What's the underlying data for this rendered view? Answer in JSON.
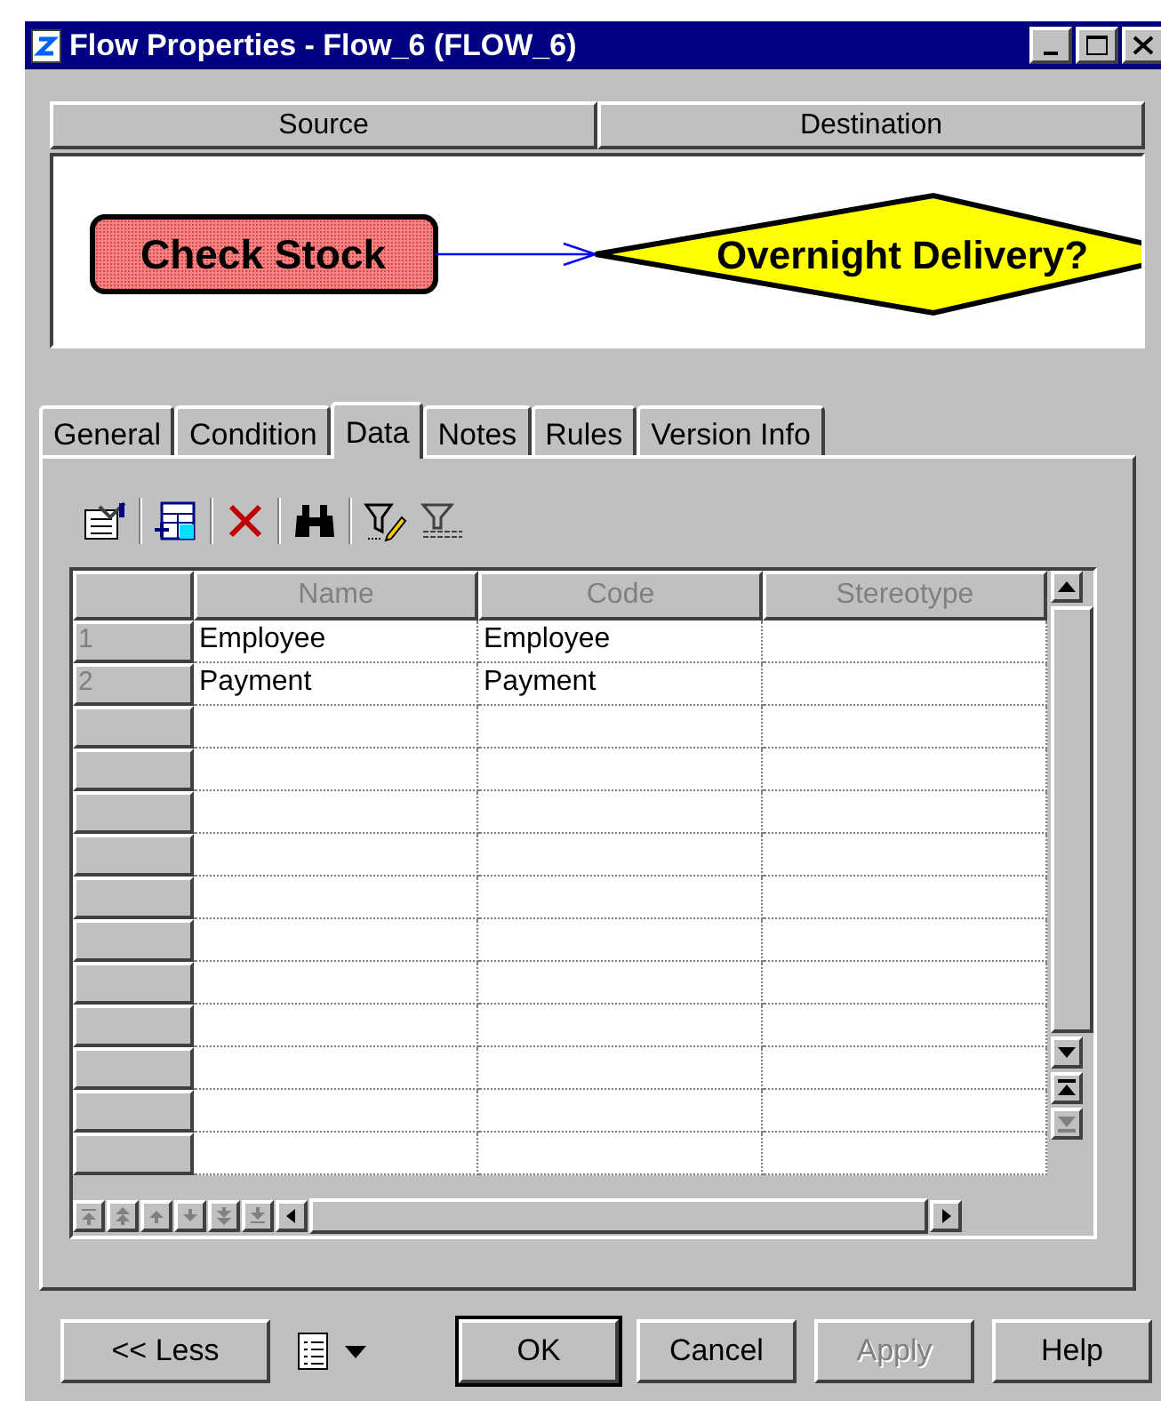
{
  "window": {
    "title": "Flow Properties - Flow_6 (FLOW_6)"
  },
  "header_tabs": [
    "Source",
    "Destination"
  ],
  "diagram": {
    "source": "Check Stock",
    "destination": "Overnight Delivery?"
  },
  "tabs": [
    {
      "label": "General",
      "selected": false
    },
    {
      "label": "Condition",
      "selected": false
    },
    {
      "label": "Data",
      "selected": true
    },
    {
      "label": "Notes",
      "selected": false
    },
    {
      "label": "Rules",
      "selected": false
    },
    {
      "label": "Version Info",
      "selected": false
    }
  ],
  "table": {
    "columns": [
      {
        "label": "Name",
        "disabled": true
      },
      {
        "label": "Code",
        "disabled": true
      },
      {
        "label": "Stereotype",
        "disabled": true
      }
    ],
    "rows": [
      {
        "number": "1",
        "cells": [
          "Employee",
          "Employee",
          ""
        ]
      },
      {
        "number": "2",
        "cells": [
          "Payment",
          "Payment",
          ""
        ]
      }
    ]
  },
  "buttons": [
    {
      "label": "<< Less",
      "default": false,
      "disabled": false
    },
    {
      "label": "OK",
      "default": true,
      "disabled": false
    },
    {
      "label": "Cancel",
      "default": false,
      "disabled": false
    },
    {
      "label": "Apply",
      "default": false,
      "disabled": true
    },
    {
      "label": "Help",
      "default": false,
      "disabled": false
    }
  ]
}
